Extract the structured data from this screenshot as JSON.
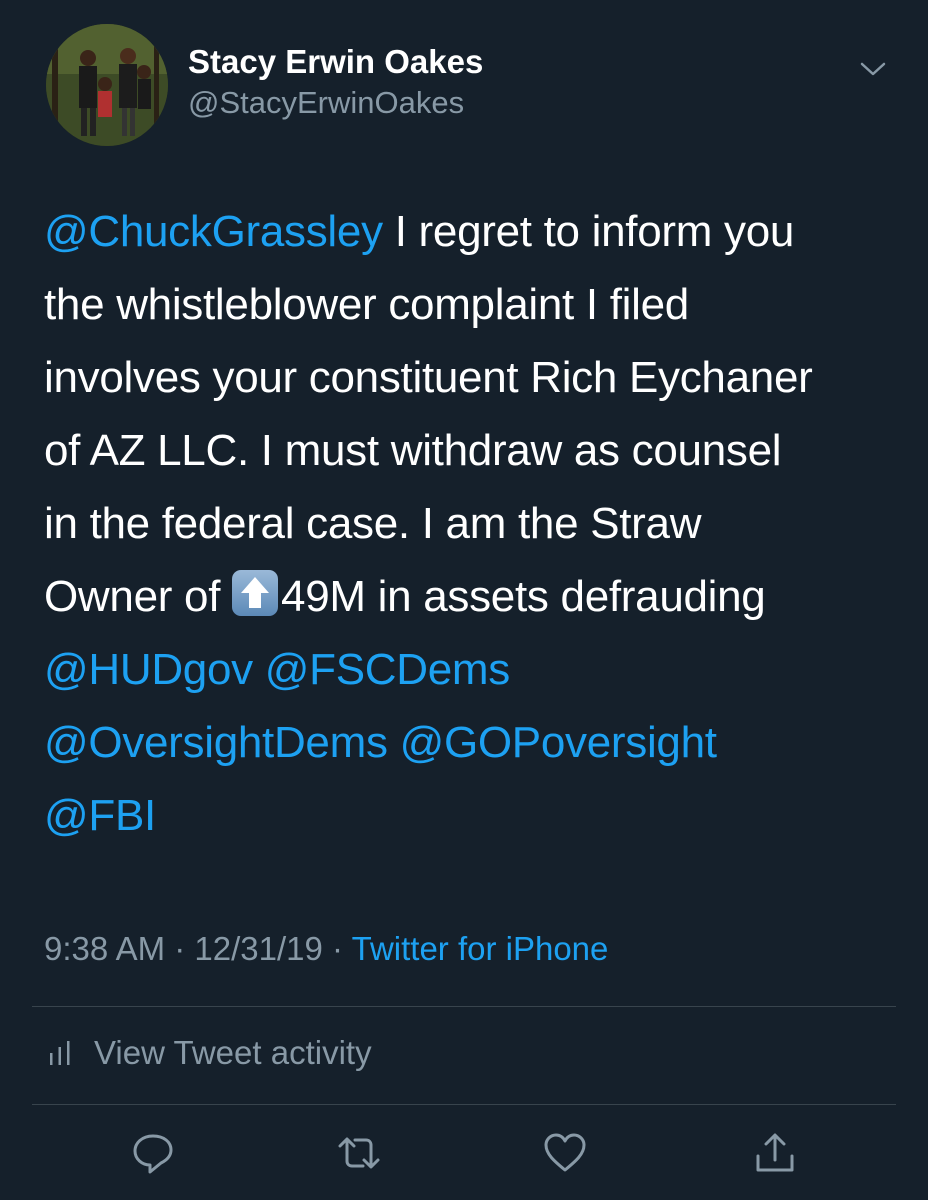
{
  "header": {
    "display_name": "Stacy Erwin Oakes",
    "handle": "@StacyErwinOakes"
  },
  "tweet": {
    "line1_mention": "@ChuckGrassley",
    "line1_text": " I regret to inform you",
    "line2": "the whistleblower complaint I filed",
    "line3": "involves your constituent Rich Eychaner",
    "line4": "of AZ LLC. I must withdraw as counsel",
    "line5": "in the federal case. I am the Straw",
    "line6_before": "Owner of ",
    "line6_after": "49M in assets  defrauding",
    "mentions_line7": [
      "@HUDgov",
      "@FSCDems"
    ],
    "mentions_line8": [
      "@OversightDems",
      "@GOPoversight"
    ],
    "mentions_line9": [
      "@FBI"
    ]
  },
  "meta": {
    "time": "9:38 AM",
    "sep1": " · ",
    "date": "12/31/19",
    "sep2": " · ",
    "source": "Twitter for iPhone"
  },
  "activity": {
    "label": "View Tweet activity"
  },
  "icons": {
    "chevron": "chevron-down-icon",
    "emoji": "up-arrow-emoji",
    "activity": "bar-chart-icon",
    "reply": "reply-icon",
    "retweet": "retweet-icon",
    "like": "heart-icon",
    "share": "share-icon"
  },
  "colors": {
    "background": "#15202b",
    "link": "#1da1f2",
    "secondary_text": "#8899a6",
    "divider": "#38444d"
  }
}
